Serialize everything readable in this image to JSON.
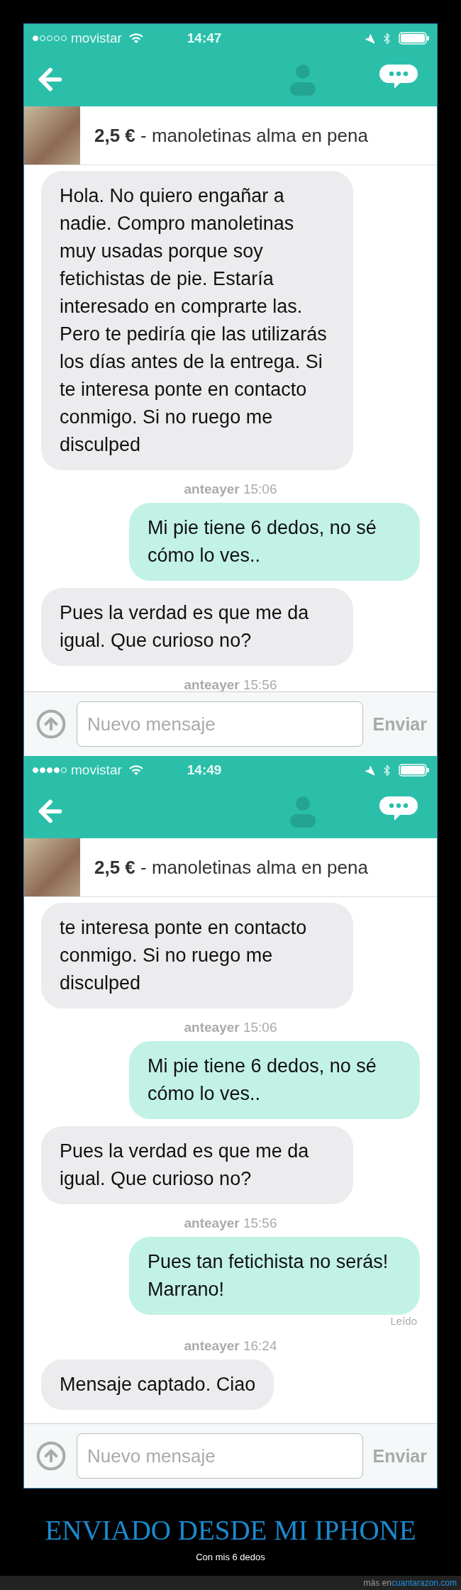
{
  "screens": [
    {
      "status": {
        "signal_dots": [
          {
            "filled": true
          },
          {
            "filled": false
          },
          {
            "filled": false
          },
          {
            "filled": false
          },
          {
            "filled": false
          }
        ],
        "carrier": "movistar",
        "time": "14:47"
      },
      "product": {
        "price": "2,5 €",
        "title": " - manoletinas alma en pena"
      },
      "messages": [
        {
          "kind": "incoming",
          "text": "Hola. No quiero engañar a nadie. Compro manoletinas muy usadas porque soy fetichistas de pie. Estaría interesado en comprarte las. Pero te pediría qie las utilizarás los días antes de la entrega. Si te interesa ponte en contacto conmigo. Si no ruego me disculped"
        },
        {
          "kind": "timestamp",
          "text": "**anteayer** 15:06"
        },
        {
          "kind": "outgoing",
          "text": "Mi pie tiene 6 dedos, no sé cómo lo ves.."
        },
        {
          "kind": "incoming",
          "text": "Pues la verdad es que me da igual. Que curioso no?"
        },
        {
          "kind": "timestamp",
          "text": "**anteayer** 15:56"
        }
      ],
      "composer": {
        "placeholder": "Nuevo mensaje",
        "send": "Enviar"
      }
    },
    {
      "status": {
        "signal_dots": [
          {
            "filled": true
          },
          {
            "filled": true
          },
          {
            "filled": true
          },
          {
            "filled": true
          },
          {
            "filled": false
          }
        ],
        "carrier": "movistar",
        "time": "14:49"
      },
      "product": {
        "price": "2,5 €",
        "title": " - manoletinas alma en pena"
      },
      "messages": [
        {
          "kind": "incoming",
          "text": "te interesa ponte en contacto conmigo. Si no ruego me disculped"
        },
        {
          "kind": "timestamp",
          "text": "**anteayer** 15:06"
        },
        {
          "kind": "outgoing",
          "text": "Mi pie tiene 6 dedos, no sé cómo lo ves.."
        },
        {
          "kind": "incoming",
          "text": "Pues la verdad es que me da igual. Que curioso no?"
        },
        {
          "kind": "timestamp",
          "text": "**anteayer** 15:56"
        },
        {
          "kind": "outgoing",
          "text": "Pues tan fetichista no serás! Marrano!"
        },
        {
          "kind": "receipt",
          "text": "Leído"
        },
        {
          "kind": "timestamp",
          "text": "**anteayer** 16:24"
        },
        {
          "kind": "incoming",
          "text": "Mensaje captado. Ciao"
        }
      ],
      "composer": {
        "placeholder": "Nuevo mensaje",
        "send": "Enviar"
      }
    }
  ],
  "caption": {
    "title": "ENVIADO DESDE MI IPHONE",
    "subtitle": "Con mis 6 dedos"
  },
  "footer": {
    "prefix": "más en ",
    "link": "cuantarazon.com"
  }
}
